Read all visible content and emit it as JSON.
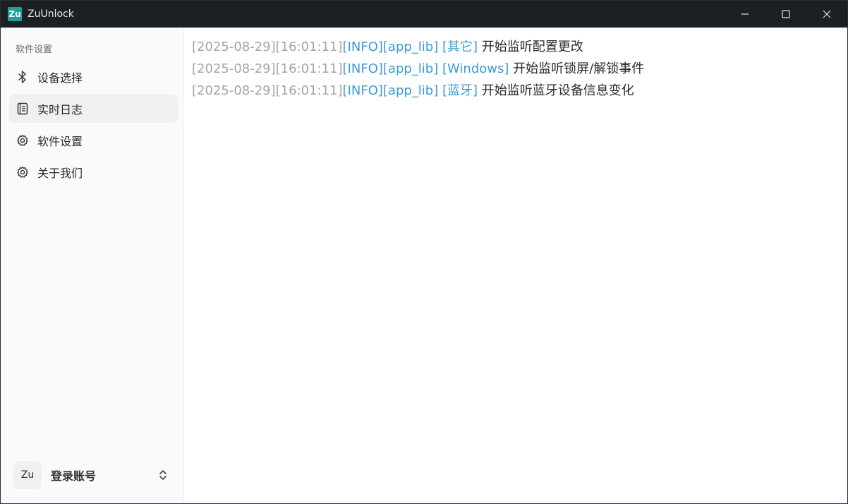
{
  "window": {
    "logo_text": "Zu",
    "title": "ZuUnlock"
  },
  "sidebar": {
    "heading": "软件设置",
    "items": [
      {
        "label": "设备选择",
        "icon": "bluetooth-icon"
      },
      {
        "label": "实时日志",
        "icon": "log-book-icon",
        "active": true
      },
      {
        "label": "软件设置",
        "icon": "gear-icon"
      },
      {
        "label": "关于我们",
        "icon": "gear-icon"
      }
    ],
    "account": {
      "avatar_text": "Zu",
      "label": "登录账号"
    }
  },
  "logs": [
    {
      "timestamp": "[2025-08-29][16:01:11]",
      "level": "[INFO][app_lib]",
      "tag": "[其它]",
      "message": "开始监听配置更改"
    },
    {
      "timestamp": "[2025-08-29][16:01:11]",
      "level": "[INFO][app_lib]",
      "tag": "[Windows]",
      "message": "开始监听锁屏/解锁事件"
    },
    {
      "timestamp": "[2025-08-29][16:01:11]",
      "level": "[INFO][app_lib]",
      "tag": "[蓝牙]",
      "message": "开始监听蓝牙设备信息变化"
    }
  ],
  "colors": {
    "titlebar": "#1c1f24",
    "accent": "#17a398",
    "log_link": "#3a9ad9",
    "log_timestamp": "#a5a5a5"
  }
}
